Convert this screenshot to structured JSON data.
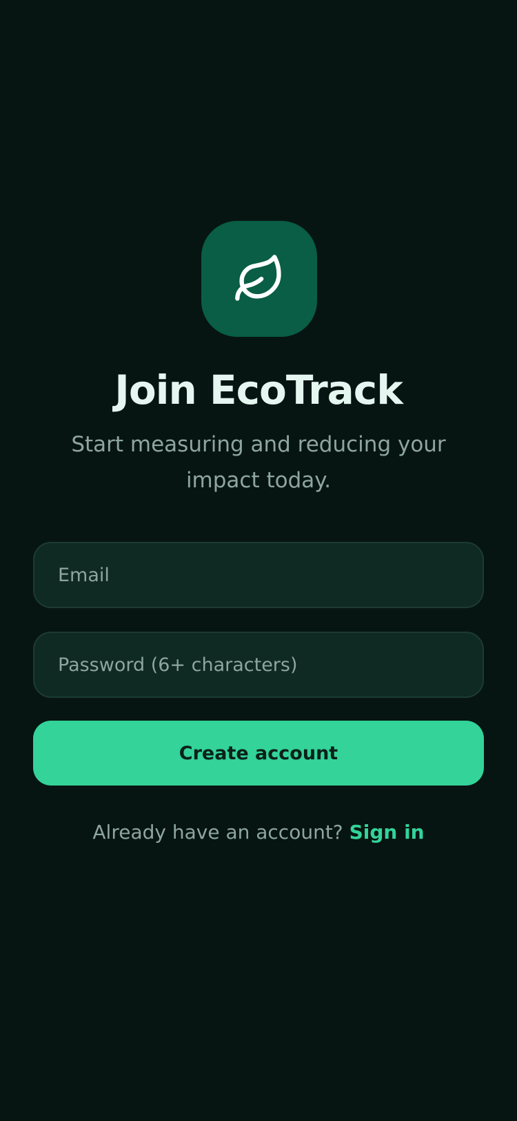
{
  "app": {
    "icon": "leaf-icon",
    "title": "Join EcoTrack",
    "subtitle": "Start measuring and reducing your impact today."
  },
  "form": {
    "email": {
      "placeholder": "Email",
      "value": ""
    },
    "password": {
      "placeholder": "Password (6+ characters)",
      "value": ""
    },
    "submit_label": "Create account"
  },
  "footer": {
    "prompt": "Already have an account?",
    "link_label": "Sign in"
  },
  "colors": {
    "background": "#071512",
    "accent": "#33d399",
    "icon_tile": "#095e45",
    "field_background": "#0f2a23",
    "title_text": "#e4f6ef",
    "muted_text": "#8ea69d"
  }
}
